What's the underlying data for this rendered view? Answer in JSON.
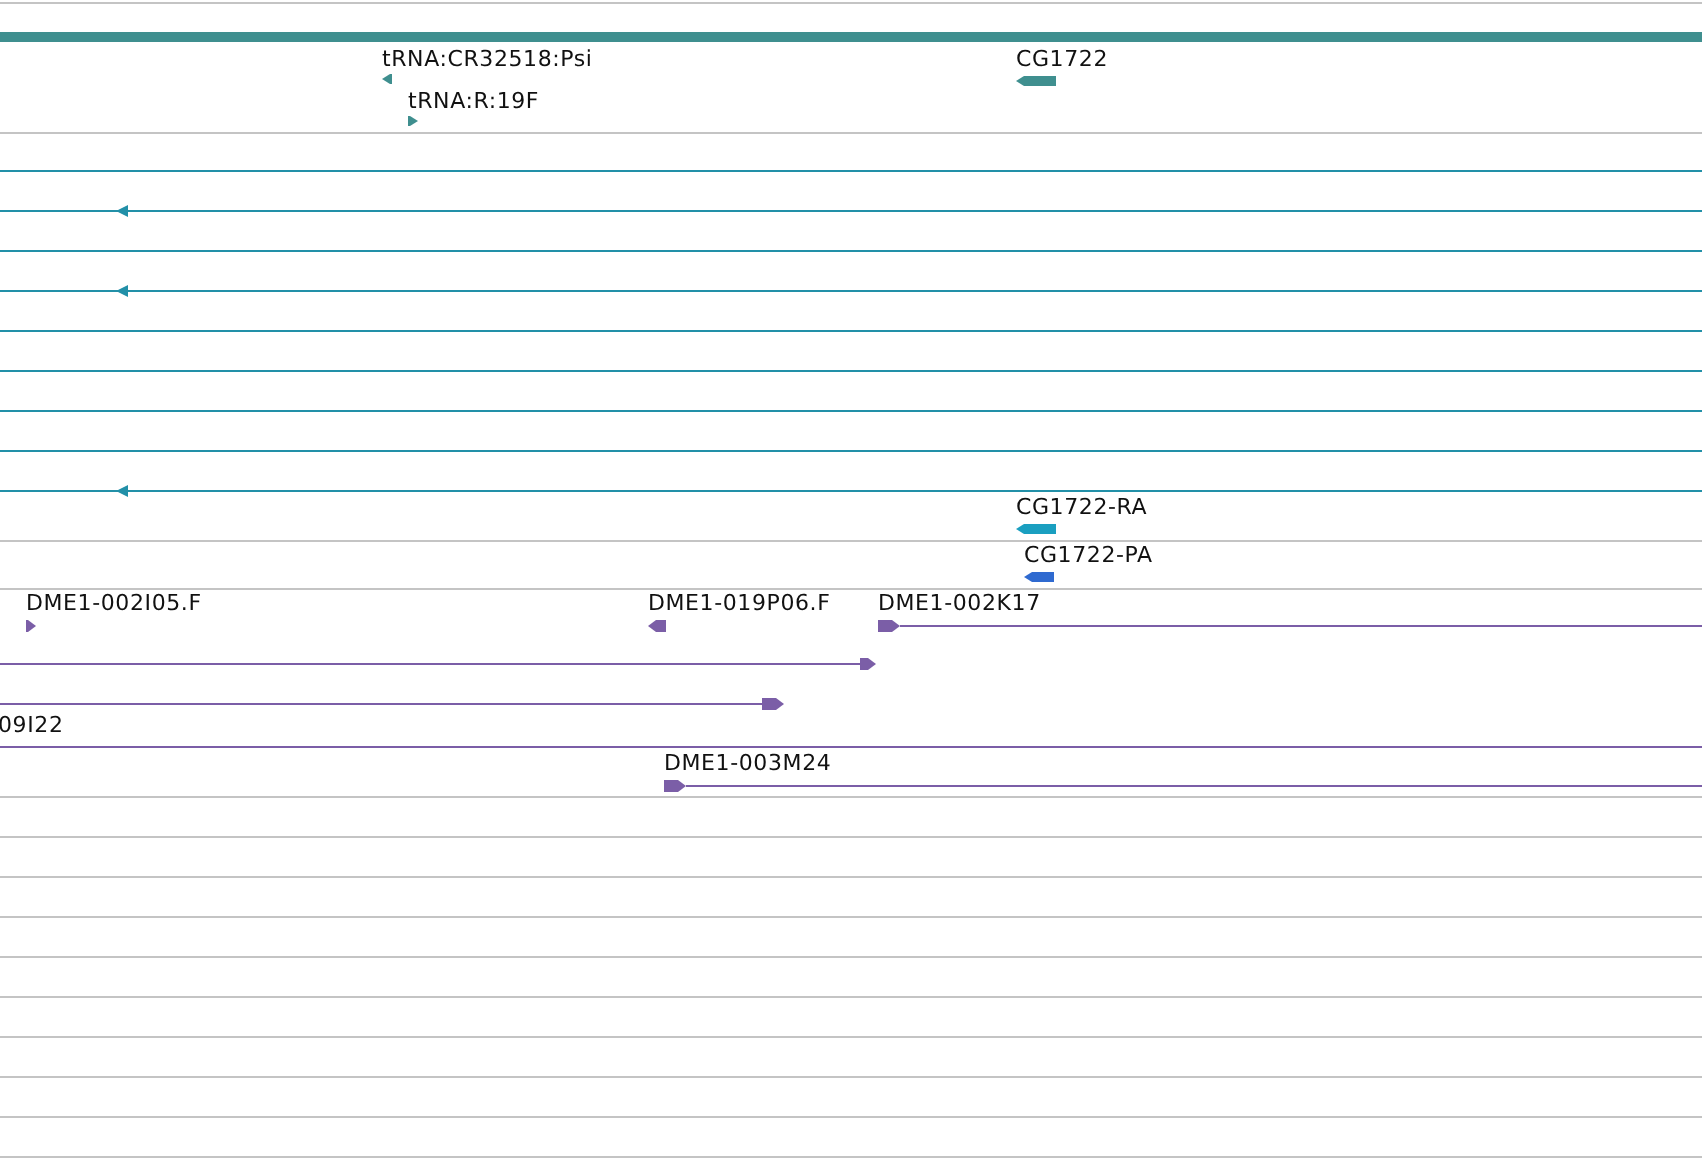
{
  "tracks": [
    {
      "features": [
        {
          "kind": "bar",
          "color": "#3f8f8f"
        },
        {
          "kind": "block",
          "label": "tRNA:CR32518:Psi",
          "reverse": true,
          "color": "#3f8f8f"
        },
        {
          "kind": "block",
          "label": "tRNA:R:19F",
          "reverse": false,
          "color": "#3f8f8f"
        },
        {
          "kind": "block",
          "label": "CG1722",
          "reverse": true,
          "color": "#3f8f8f"
        }
      ]
    },
    {
      "features": [
        {
          "kind": "line",
          "color": "#2290a8"
        },
        {
          "kind": "arrow_line",
          "color": "#2290a8"
        },
        {
          "kind": "line",
          "color": "#2290a8"
        },
        {
          "kind": "arrow_line",
          "color": "#2290a8"
        },
        {
          "kind": "line",
          "color": "#2290a8"
        },
        {
          "kind": "line",
          "color": "#2290a8"
        },
        {
          "kind": "line",
          "color": "#2290a8"
        },
        {
          "kind": "line",
          "color": "#2290a8"
        },
        {
          "kind": "arrow_line",
          "color": "#2290a8"
        },
        {
          "kind": "block",
          "label": "CG1722-RA",
          "reverse": true,
          "color": "#1a9fc0"
        }
      ]
    },
    {
      "features": [
        {
          "kind": "block",
          "label": "CG1722-PA",
          "reverse": true,
          "color": "#2f6ad0"
        }
      ]
    },
    {
      "features": [
        {
          "kind": "block",
          "label": "DME1-002I05.F",
          "reverse": false,
          "color": "#7b5ea7"
        },
        {
          "kind": "block",
          "label": "DME1-019P06.F",
          "reverse": true,
          "color": "#7b5ea7"
        },
        {
          "kind": "pair_right",
          "label": "DME1-002K17",
          "reverse": false,
          "color": "#7b5ea7"
        },
        {
          "kind": "pair_left",
          "reverse": false,
          "color": "#7b5ea7"
        },
        {
          "kind": "pair_left",
          "reverse": false,
          "color": "#7b5ea7"
        },
        {
          "kind": "line",
          "label": "09I22",
          "color": "#7b5ea7"
        },
        {
          "kind": "pair_right",
          "label": "DME1-003M24",
          "reverse": false,
          "color": "#7b5ea7"
        }
      ]
    }
  ]
}
